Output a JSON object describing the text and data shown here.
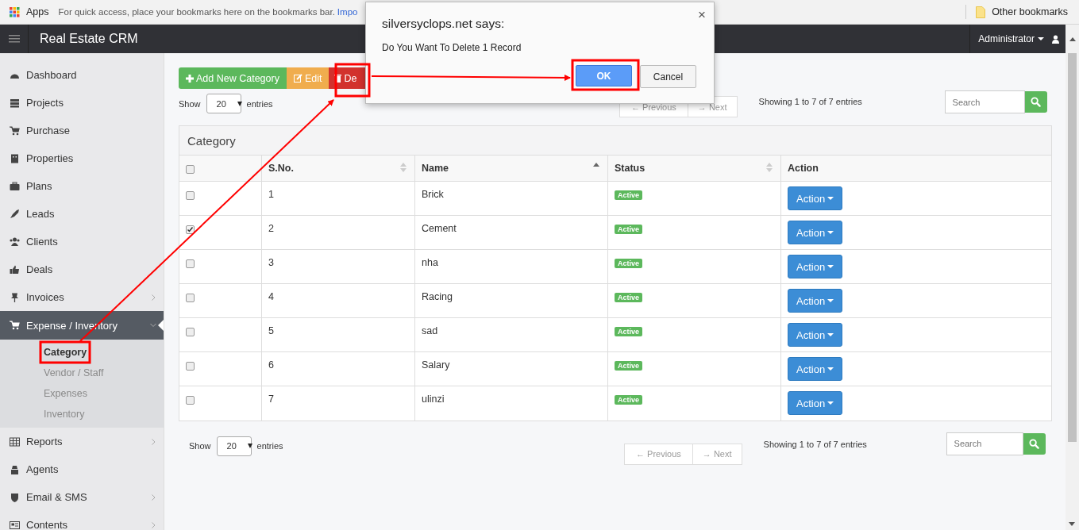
{
  "browser_bar": {
    "apps_label": "Apps",
    "hint": "For quick access, place your bookmarks here on the bookmarks bar.",
    "import_link": "Impo",
    "other_bookmarks": "Other bookmarks"
  },
  "header": {
    "title": "Real Estate CRM",
    "user": "Administrator"
  },
  "sidebar": {
    "items": [
      {
        "label": "Dashboard",
        "has_children": false,
        "expanded": false
      },
      {
        "label": "Projects",
        "has_children": false,
        "expanded": false
      },
      {
        "label": "Purchase",
        "has_children": false,
        "expanded": false
      },
      {
        "label": "Properties",
        "has_children": false,
        "expanded": false
      },
      {
        "label": "Plans",
        "has_children": false,
        "expanded": false
      },
      {
        "label": "Leads",
        "has_children": false,
        "expanded": false
      },
      {
        "label": "Clients",
        "has_children": false,
        "expanded": false
      },
      {
        "label": "Deals",
        "has_children": false,
        "expanded": false
      },
      {
        "label": "Invoices",
        "has_children": true,
        "expanded": false
      },
      {
        "label": "Expense / Inventory",
        "has_children": true,
        "expanded": true,
        "children": [
          {
            "label": "Category",
            "selected": true
          },
          {
            "label": "Vendor / Staff",
            "selected": false
          },
          {
            "label": "Expenses",
            "selected": false
          },
          {
            "label": "Inventory",
            "selected": false
          }
        ]
      },
      {
        "label": "Reports",
        "has_children": true,
        "expanded": false
      },
      {
        "label": "Agents",
        "has_children": false,
        "expanded": false
      },
      {
        "label": "Email & SMS",
        "has_children": true,
        "expanded": false
      },
      {
        "label": "Contents",
        "has_children": true,
        "expanded": false
      }
    ]
  },
  "toolbar": [
    {
      "kind": "add",
      "label": "Add New Category"
    },
    {
      "kind": "edit",
      "label": "Edit"
    },
    {
      "kind": "delete",
      "label": "De"
    }
  ],
  "top_controls": {
    "show_label": "Show",
    "length": "20",
    "entries_label": "entries",
    "previous": "← Previous",
    "next": "→ Next",
    "info": "Showing 1 to 7 of 7 entries",
    "search_placeholder": "Search"
  },
  "panel": {
    "title": "Category",
    "select_all_checked": false,
    "columns": [
      {
        "sortable": false
      },
      {
        "label": "S.No.",
        "sortable": true,
        "sorted": false
      },
      {
        "label": "Name",
        "sortable": true,
        "sorted": true
      },
      {
        "label": "Status",
        "sortable": true,
        "sorted": false
      },
      {
        "label": "Action",
        "sortable": false
      }
    ],
    "rows": [
      {
        "checked": false,
        "sno": "1",
        "name": "Brick",
        "status": "Active",
        "action": "Action"
      },
      {
        "checked": true,
        "sno": "2",
        "name": "Cement",
        "status": "Active",
        "action": "Action"
      },
      {
        "checked": false,
        "sno": "3",
        "name": "nha",
        "status": "Active",
        "action": "Action"
      },
      {
        "checked": false,
        "sno": "4",
        "name": "Racing",
        "status": "Active",
        "action": "Action"
      },
      {
        "checked": false,
        "sno": "5",
        "name": "sad",
        "status": "Active",
        "action": "Action"
      },
      {
        "checked": false,
        "sno": "6",
        "name": "Salary",
        "status": "Active",
        "action": "Action"
      },
      {
        "checked": false,
        "sno": "7",
        "name": "ulinzi",
        "status": "Active",
        "action": "Action"
      }
    ]
  },
  "bottom_controls": {
    "show_label": "Show",
    "length": "20",
    "entries_label": "entries",
    "previous": "← Previous",
    "next": "→ Next",
    "info": "Showing 1 to 7 of 7 entries",
    "search_placeholder": "Search"
  },
  "dialog": {
    "title": "silversyclops.net says:",
    "message": "Do You Want To Delete 1 Record",
    "ok": "OK",
    "cancel": "Cancel",
    "close": "×"
  }
}
